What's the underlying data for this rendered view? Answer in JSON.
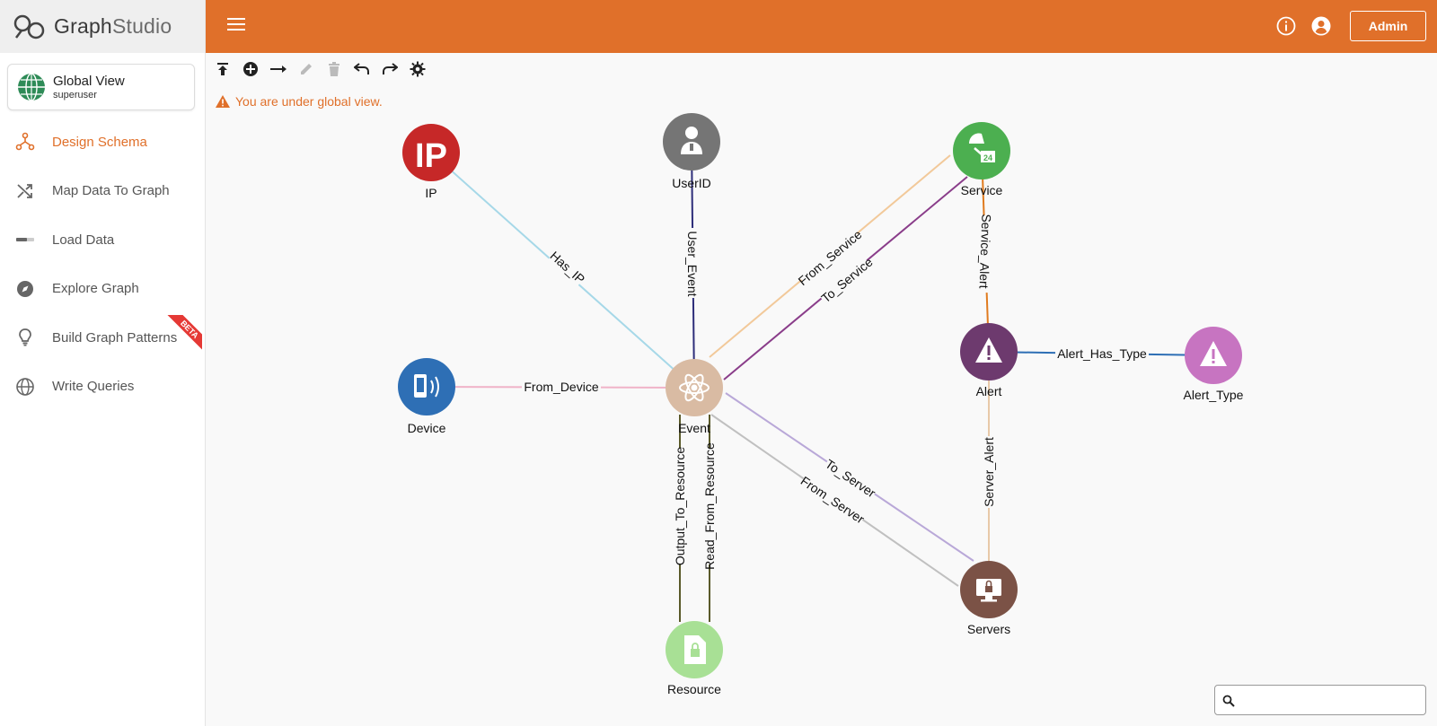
{
  "app": {
    "logo_bold": "Graph",
    "logo_light": "Studio"
  },
  "global_view": {
    "title": "Global View",
    "user": "superuser"
  },
  "nav": [
    {
      "label": "Design Schema",
      "icon": "schema-icon",
      "active": true
    },
    {
      "label": "Map Data To Graph",
      "icon": "shuffle-icon"
    },
    {
      "label": "Load Data",
      "icon": "progress-bar-icon"
    },
    {
      "label": "Explore Graph",
      "icon": "compass-icon"
    },
    {
      "label": "Build Graph Patterns",
      "icon": "lightbulb-icon",
      "badge": "BETA"
    },
    {
      "label": "Write Queries",
      "icon": "globe-query-icon"
    }
  ],
  "topbar": {
    "admin_label": "Admin",
    "accent": "#e0702a"
  },
  "toolbar": [
    "publish-icon",
    "add-vertex-icon",
    "add-edge-icon",
    "edit-icon",
    "delete-icon",
    "undo-icon",
    "redo-icon",
    "settings-icon"
  ],
  "warning": {
    "text": "You are under global view."
  },
  "search": {
    "placeholder": "",
    "value": ""
  },
  "schema": {
    "vertices": [
      {
        "id": "IP",
        "label": "IP",
        "color": "#c62828",
        "icon": "ip-icon"
      },
      {
        "id": "UserID",
        "label": "UserID",
        "color": "#757575",
        "icon": "user-badge-icon"
      },
      {
        "id": "Service",
        "label": "Service",
        "color": "#4caf50",
        "icon": "service-24-icon"
      },
      {
        "id": "Device",
        "label": "Device",
        "color": "#2e6fb5",
        "icon": "mobile-device-icon"
      },
      {
        "id": "Event",
        "label": "Event",
        "color": "#d9bba3",
        "icon": "atom-icon"
      },
      {
        "id": "Alert",
        "label": "Alert",
        "color": "#6d3a6e",
        "icon": "warning-icon"
      },
      {
        "id": "Alert_Type",
        "label": "Alert_Type",
        "color": "#c774c1",
        "icon": "warning-icon"
      },
      {
        "id": "Servers",
        "label": "Servers",
        "color": "#7b5246",
        "icon": "server-lock-icon"
      },
      {
        "id": "Resource",
        "label": "Resource",
        "color": "#a8e095",
        "icon": "locked-file-icon"
      }
    ],
    "edges": [
      {
        "label": "Has_IP",
        "from": "IP",
        "to": "Event",
        "color": "#a6d8e8"
      },
      {
        "label": "User_Event",
        "from": "UserID",
        "to": "Event",
        "color": "#2e2e7a"
      },
      {
        "label": "From_Service",
        "from": "Service",
        "to": "Event",
        "color": "#f2c99a"
      },
      {
        "label": "To_Service",
        "from": "Event",
        "to": "Service",
        "color": "#8a3d8a"
      },
      {
        "label": "Service_Alert",
        "from": "Service",
        "to": "Alert",
        "color": "#e07b1f"
      },
      {
        "label": "Alert_Has_Type",
        "from": "Alert",
        "to": "Alert_Type",
        "color": "#2e6fb5"
      },
      {
        "label": "From_Device",
        "from": "Device",
        "to": "Event",
        "color": "#f0b3c8"
      },
      {
        "label": "Server_Alert",
        "from": "Servers",
        "to": "Alert",
        "color": "#e8c9a8"
      },
      {
        "label": "To_Server",
        "from": "Event",
        "to": "Servers",
        "color": "#b9a8d8"
      },
      {
        "label": "From_Server",
        "from": "Servers",
        "to": "Event",
        "color": "#c0c0c0"
      },
      {
        "label": "Output_To_Resource",
        "from": "Event",
        "to": "Resource",
        "color": "#5a5a2a"
      },
      {
        "label": "Read_From_Resource",
        "from": "Resource",
        "to": "Event",
        "color": "#5a5a2a"
      }
    ]
  }
}
